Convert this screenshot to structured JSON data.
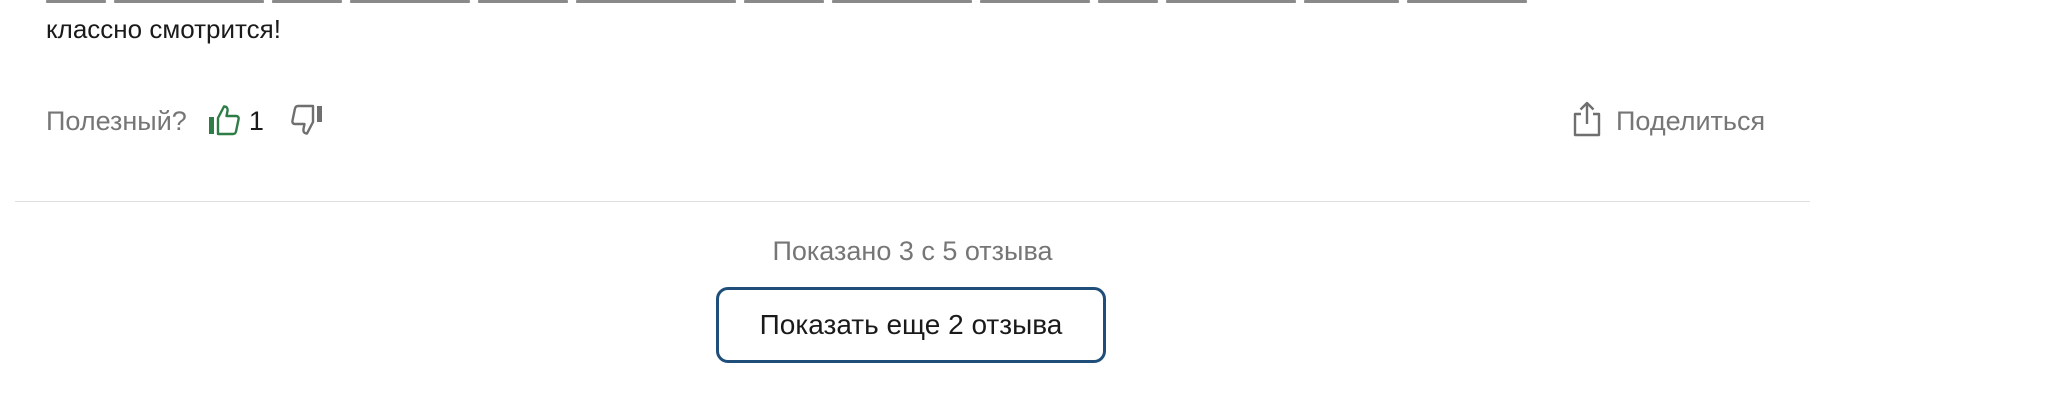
{
  "review": {
    "text_tail": "классно смотрится!"
  },
  "feedback": {
    "helpful_label": "Полезный?",
    "like_icon": "thumbs-up-icon",
    "like_count": "1",
    "dislike_icon": "thumbs-down-icon",
    "like_color": "#2e7d46"
  },
  "share": {
    "icon": "share-icon",
    "label": "Поделиться"
  },
  "pagination": {
    "shown_text": "Показано 3 с 5 отзыва",
    "more_button_label": "Показать еще 2 отзыва",
    "button_border_color": "#1f4e7a"
  }
}
